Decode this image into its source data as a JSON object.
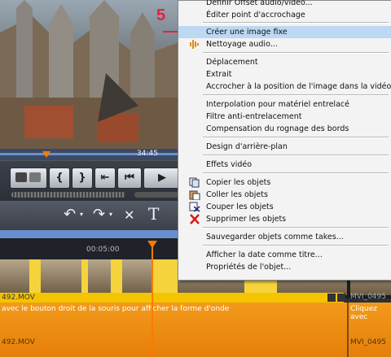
{
  "preview": {
    "playhead_time": "34:45"
  },
  "timeline": {
    "ruler_time": "00:05:00"
  },
  "tracks": {
    "video_clip_label": "492.MOV",
    "next_clip_label": "MVI_0495",
    "audio_hint": "avec le bouton droit de la souris pour afficher la forme d'onde",
    "audio_next_hint": "Cliquez avec",
    "audio_clip_label": "492.MOV",
    "audio_next_label": "MVI_0495"
  },
  "step_marker": "5",
  "context_menu": {
    "items": [
      {
        "label": "Définir Offset audio/vidéo...",
        "group": 0
      },
      {
        "label": "Éditer point d'accrochage",
        "group": 0
      },
      {
        "label": "Créer une image fixe",
        "group": 1,
        "highlighted": true
      },
      {
        "label": "Nettoyage audio...",
        "group": 1,
        "icon": "audio-wave-icon"
      },
      {
        "label": "Déplacement",
        "group": 2
      },
      {
        "label": "Extrait",
        "group": 2
      },
      {
        "label": "Accrocher à la position de l'image dans la vidéo...",
        "group": 2
      },
      {
        "label": "Interpolation pour matériel entrelacé",
        "group": 3
      },
      {
        "label": "Filtre anti-entrelacement",
        "group": 3
      },
      {
        "label": "Compensation du rognage des bords",
        "group": 3
      },
      {
        "label": "Design d'arrière-plan",
        "group": 4
      },
      {
        "label": "Effets vidéo",
        "group": 5
      },
      {
        "label": "Copier les objets",
        "group": 6,
        "icon": "copy-icon"
      },
      {
        "label": "Coller les objets",
        "group": 6,
        "icon": "paste-icon"
      },
      {
        "label": "Couper les objets",
        "group": 6,
        "icon": "cut-icon"
      },
      {
        "label": "Supprimer les objets",
        "group": 6,
        "icon": "delete-icon"
      },
      {
        "label": "Sauvegarder objets comme takes...",
        "group": 7
      },
      {
        "label": "Afficher la date comme titre...",
        "group": 8
      },
      {
        "label": "Propriétés de l'objet...",
        "group": 8
      }
    ]
  },
  "colors": {
    "highlight": "#bcd8f2",
    "accent": "#ff7a00",
    "step": "#e8203a"
  }
}
